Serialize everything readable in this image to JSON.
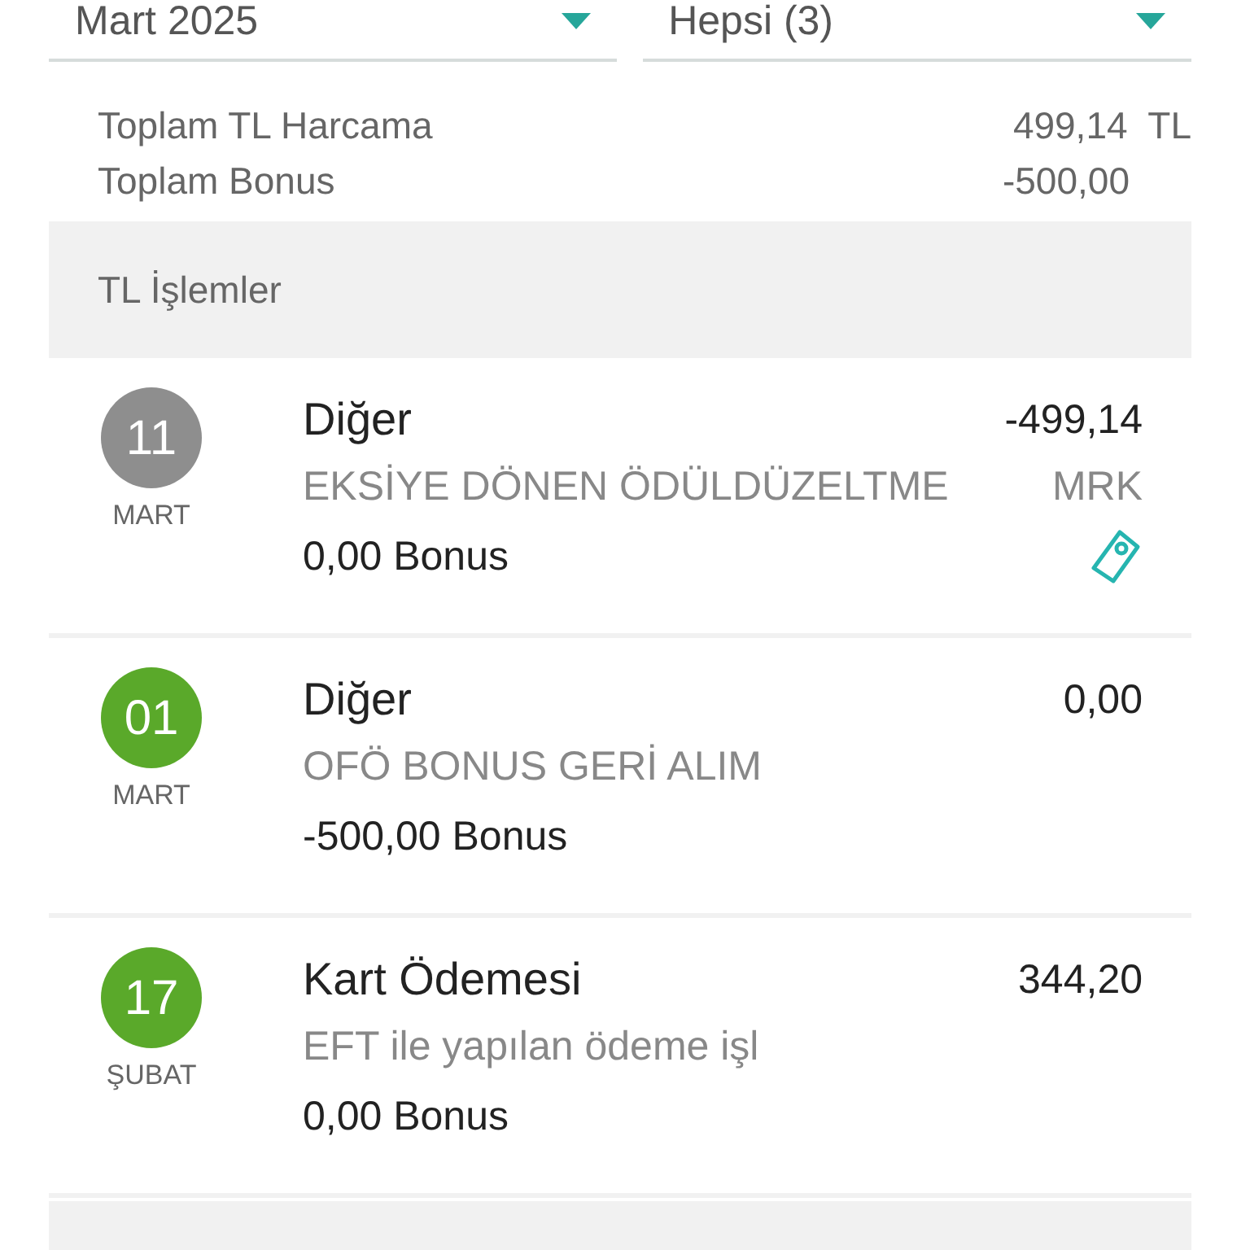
{
  "filters": [
    {
      "value": "Mart 2025"
    },
    {
      "value": "Hepsi (3)"
    }
  ],
  "summary": [
    {
      "label": "Toplam TL Harcama",
      "value": "499,14  TL"
    },
    {
      "label": "Toplam Bonus",
      "value": "-500,00"
    }
  ],
  "section_title": "TL İşlemler",
  "transactions": [
    {
      "day": "11",
      "month": "MART",
      "color": "#8e8e8e",
      "title": "Diğer",
      "amount": "-499,14",
      "description": "EKSİYE DÖNEN ÖDÜLDÜZELTME",
      "suffix": "MRK",
      "bonus": "0,00 Bonus",
      "tagged": true
    },
    {
      "day": "01",
      "month": "MART",
      "color": "#5aa92a",
      "title": "Diğer",
      "amount": "0,00",
      "description": "OFÖ BONUS GERİ ALIM",
      "bonus": "-500,00 Bonus",
      "tagged": false
    },
    {
      "day": "17",
      "month": "ŞUBAT",
      "color": "#5aa92a",
      "title": "Kart Ödemesi",
      "amount": "344,20",
      "description": "EFT ile yapılan ödeme işl",
      "bonus": "0,00 Bonus",
      "tagged": false
    }
  ]
}
